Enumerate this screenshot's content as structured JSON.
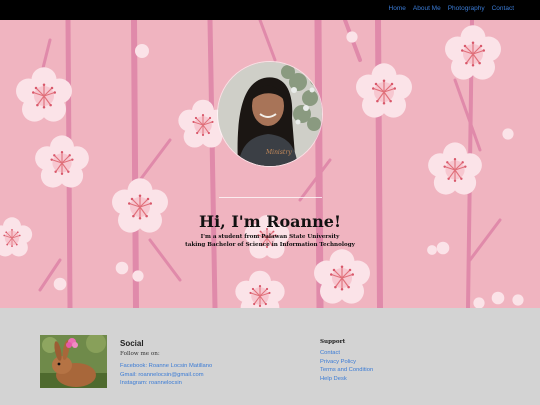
{
  "nav": {
    "links": [
      "Home",
      "About Me",
      "Photography",
      "Contact"
    ]
  },
  "hero": {
    "title": "Hi, I'm Roanne!",
    "subtitle_line1": "I'm a student from Palawan State University",
    "subtitle_line2": "taking Bachelor of Science in Information Technology"
  },
  "footer": {
    "social": {
      "title": "Social",
      "follow": "Follow me on:",
      "links": [
        "Facebook: Roanne Locsin Matillano",
        "Gmail: roannelocsin@gmail.com",
        "Instagram: roannelocsin"
      ]
    },
    "support": {
      "title": "Support",
      "links": [
        "Contact",
        "Privacy Policy",
        "Terms and Condition",
        "Help Desk"
      ]
    }
  },
  "colors": {
    "navbar": "#000000",
    "link": "#3a7bd5",
    "hero_bg": "#f0b4c0",
    "branch": "#e08aaa",
    "blossom": "#fbe3e8",
    "blossom_center": "#e0707a",
    "footer_bg": "#d3d3d3"
  },
  "icons": {
    "profile": "profile-photo",
    "rabbit": "rabbit-photo"
  }
}
